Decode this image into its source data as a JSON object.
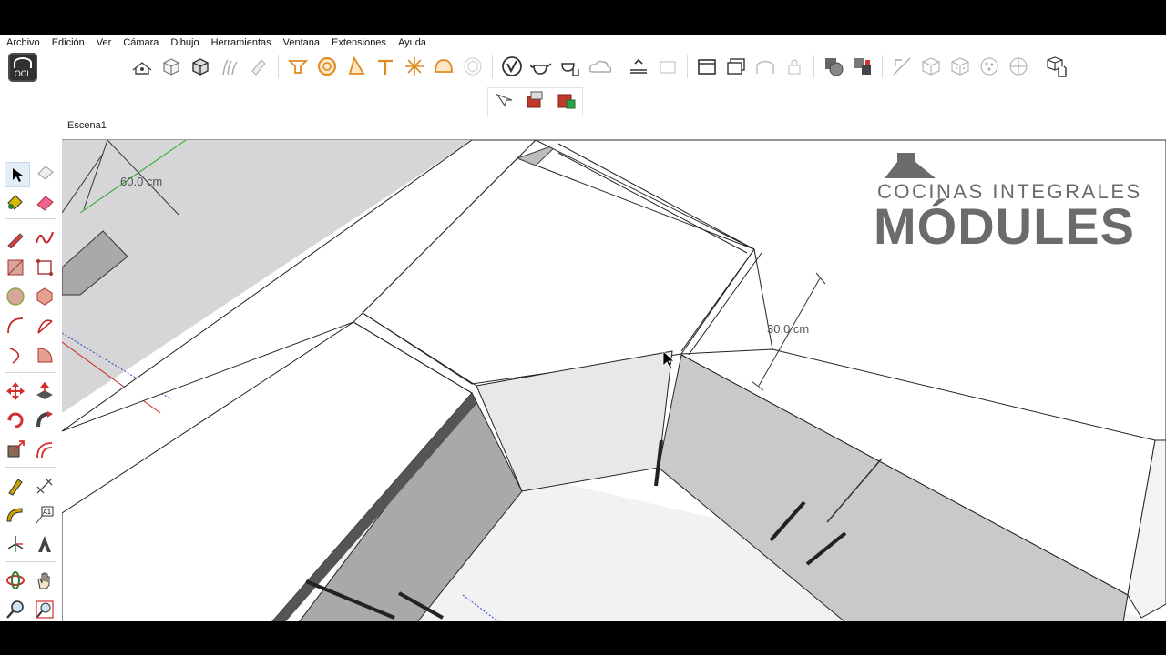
{
  "menu": [
    "Archivo",
    "Edición",
    "Ver",
    "Cámara",
    "Dibujo",
    "Herramientas",
    "Ventana",
    "Extensiones",
    "Ayuda"
  ],
  "logo_text": "OCL",
  "scene_tab": "Escena1",
  "dimensions": {
    "left": "60.0 cm",
    "right": "30.0 cm"
  },
  "brand": {
    "top": "COCINAS INTEGRALES",
    "main": "MÓDULES"
  },
  "colors": {
    "gray_face": "#c9c9c9",
    "dark_face": "#a9a9a9",
    "light_face": "#e8e8e6",
    "brand": "#6b6b6b",
    "axis_red": "#cc2222",
    "axis_green": "#22aa22",
    "axis_blue": "#2244cc"
  },
  "toolbar_icons": [
    "house-icon",
    "cube-icon",
    "cube-solid-icon",
    "grass-icon",
    "pencil-stack-icon",
    "tray-icon",
    "circle-target-icon",
    "cone-icon",
    "tee-icon",
    "burst-icon",
    "dome-icon",
    "cube-ghost-icon",
    "v-logo-icon",
    "teapot-icon",
    "teapot-hand-icon",
    "cloud-icon",
    "layer-top-icon",
    "layer-box-icon",
    "window-icon",
    "window-stack-icon",
    "window-arch-icon",
    "lock-icon",
    "solid-union-icon",
    "solid-subtract-icon",
    "slice-icon",
    "cube-outline-icon",
    "cube-dots-icon",
    "sphere-icon",
    "sphere-split-icon",
    "hand-cube-icon"
  ],
  "left_tools": [
    "select-icon",
    "eraser-soft-icon",
    "paint-bucket-icon",
    "eraser-icon",
    "pencil-icon",
    "freehand-icon",
    "rectangle-icon",
    "rotated-rect-icon",
    "circle-icon",
    "polygon-icon",
    "arc-icon",
    "pie-arc-icon",
    "three-point-arc-icon",
    "pie-icon",
    "move-icon",
    "push-pull-icon",
    "rotate-icon",
    "follow-me-icon",
    "scale-icon",
    "offset-icon",
    "tape-measure-icon",
    "dimension-icon",
    "protractor-icon",
    "text-icon",
    "axes-icon",
    "3d-text-icon",
    "orbit-icon",
    "pan-icon",
    "zoom-icon",
    "zoom-window-icon",
    "zoom-extents-icon",
    "previous-view-icon"
  ]
}
